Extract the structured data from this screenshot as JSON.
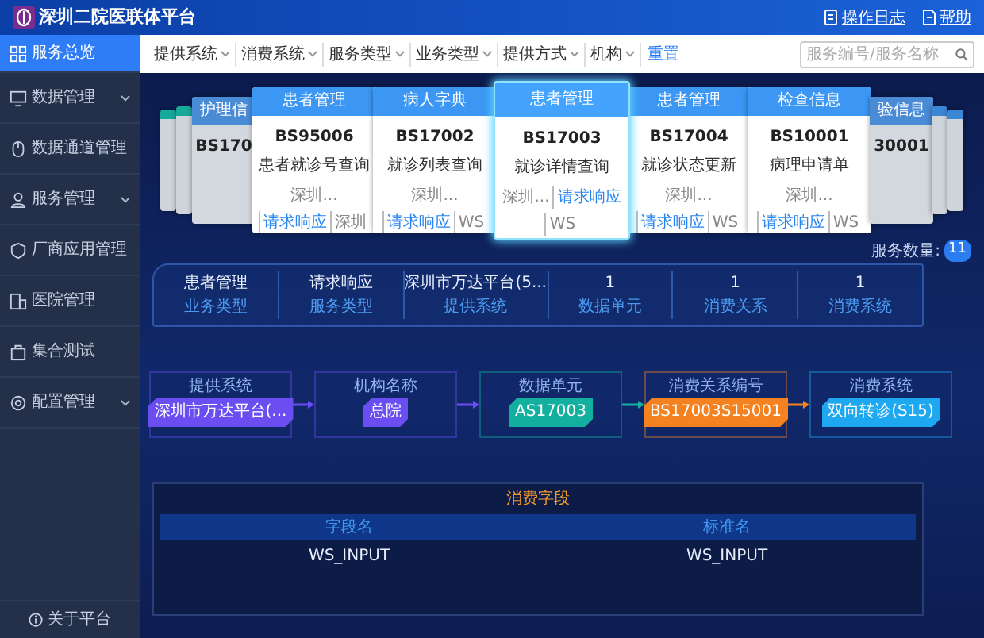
{
  "header": {
    "title": "深圳二院医联体平台",
    "actions": [
      {
        "label": "操作日志"
      },
      {
        "label": "帮助"
      }
    ]
  },
  "sidebar": {
    "items": [
      {
        "label": "服务总览",
        "selected": true,
        "has_submenu": false
      },
      {
        "label": "数据管理",
        "selected": false,
        "has_submenu": true
      },
      {
        "label": "数据通道管理",
        "selected": false,
        "has_submenu": false
      },
      {
        "label": "服务管理",
        "selected": false,
        "has_submenu": true
      },
      {
        "label": "厂商应用管理",
        "selected": false,
        "has_submenu": false
      },
      {
        "label": "医院管理",
        "selected": false,
        "has_submenu": false
      },
      {
        "label": "集合测试",
        "selected": false,
        "has_submenu": false
      },
      {
        "label": "配置管理",
        "selected": false,
        "has_submenu": true
      }
    ],
    "footer": "关于平台"
  },
  "filters": {
    "items": [
      "提供系统",
      "消费系统",
      "服务类型",
      "业务类型",
      "提供方式",
      "机构"
    ],
    "reset": "重置",
    "search": {
      "placeholder": "服务编号/服务名称"
    }
  },
  "cards": [
    {
      "kind": "edge",
      "color": "#17a99a"
    },
    {
      "kind": "edge",
      "color": "#17a99a"
    },
    {
      "kind": "partial",
      "category": "护理信",
      "code": "BS170"
    },
    {
      "kind": "main",
      "selected": false,
      "category": "患者管理",
      "code": "BS95006",
      "name": "患者就诊号查询",
      "provider": "深圳...",
      "mode": "请求响应",
      "protocol": "深圳"
    },
    {
      "kind": "main",
      "selected": false,
      "category": "病人字典",
      "code": "BS17002",
      "name": "就诊列表查询",
      "provider": "深圳...",
      "mode": "请求响应",
      "protocol": "WS"
    },
    {
      "kind": "main",
      "selected": true,
      "category": "患者管理",
      "code": "BS17003",
      "name": "就诊详情查询",
      "provider": "深圳...",
      "mode": "请求响应",
      "protocol": "WS"
    },
    {
      "kind": "main",
      "selected": false,
      "category": "患者管理",
      "code": "BS17004",
      "name": "就诊状态更新",
      "provider": "深圳...",
      "mode": "请求响应",
      "protocol": "WS"
    },
    {
      "kind": "main",
      "selected": false,
      "category": "检查信息",
      "code": "BS10001",
      "name": "病理申请单",
      "provider": "深圳...",
      "mode": "请求响应",
      "protocol": "WS"
    },
    {
      "kind": "partial",
      "category": "验信息",
      "code": "30001"
    },
    {
      "kind": "edge",
      "color": "#3c86d6"
    },
    {
      "kind": "edge",
      "color": "#3c86d6"
    }
  ],
  "service_count": {
    "label": "服务数量:",
    "count": "11"
  },
  "summary": [
    {
      "value": "患者管理",
      "label": "业务类型"
    },
    {
      "value": "请求响应",
      "label": "服务类型"
    },
    {
      "value": "深圳市万达平台(5...",
      "label": "提供系统"
    },
    {
      "value": "1",
      "label": "数据单元"
    },
    {
      "value": "1",
      "label": "消费关系"
    },
    {
      "value": "1",
      "label": "消费系统"
    }
  ],
  "flow": [
    {
      "label": "提供系统",
      "value": "深圳市万达平台(...",
      "color": "#6a4ef2"
    },
    {
      "label": "机构名称",
      "value": "总院",
      "color": "#6a4ef2"
    },
    {
      "label": "数据单元",
      "value": "AS17003",
      "color": "#14b09f"
    },
    {
      "label": "消费关系编号",
      "value": "BS17003S15001",
      "color": "#f58220"
    },
    {
      "label": "消费系统",
      "value": "双向转诊(S15)",
      "color": "#1ea8f0"
    }
  ],
  "consumed_fields": {
    "title": "消费字段",
    "columns": [
      "字段名",
      "标准名"
    ],
    "rows": [
      [
        "WS_INPUT",
        "WS_INPUT"
      ]
    ]
  }
}
